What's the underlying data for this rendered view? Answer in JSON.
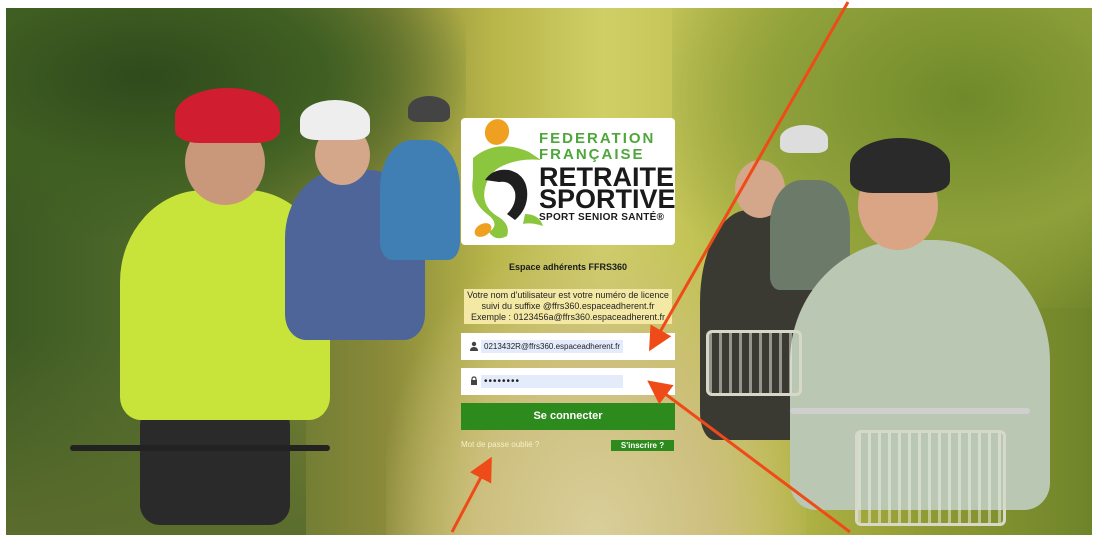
{
  "logo": {
    "line1": "FEDERATION",
    "line2": "FRANÇAISE",
    "line3": "RETRAITE",
    "line4": "SPORTIVE",
    "tagline": "SPORT SENIOR SANTÉ®"
  },
  "login": {
    "heading": "Espace adhérents FFRS360",
    "info_line1": "Votre nom d'utilisateur est votre numéro de licence",
    "info_line2": "suivi du suffixe @ffrs360.espaceadherent.fr",
    "info_line3": "Exemple : 0123456a@ffrs360.espaceadherent.fr",
    "username_value": "0213432R@ffrs360.espaceadherent.fr",
    "password_value": "••••••••",
    "connect_label": "Se connecter",
    "forgot_label": "Mot de passe oublié ?",
    "signup_label": "S'inscrire ?"
  },
  "colors": {
    "button_green": "#2d8a1c",
    "info_bg": "#f4e9a4",
    "arrow": "#ef4b18",
    "autofill_bg": "#e4ecfb"
  }
}
